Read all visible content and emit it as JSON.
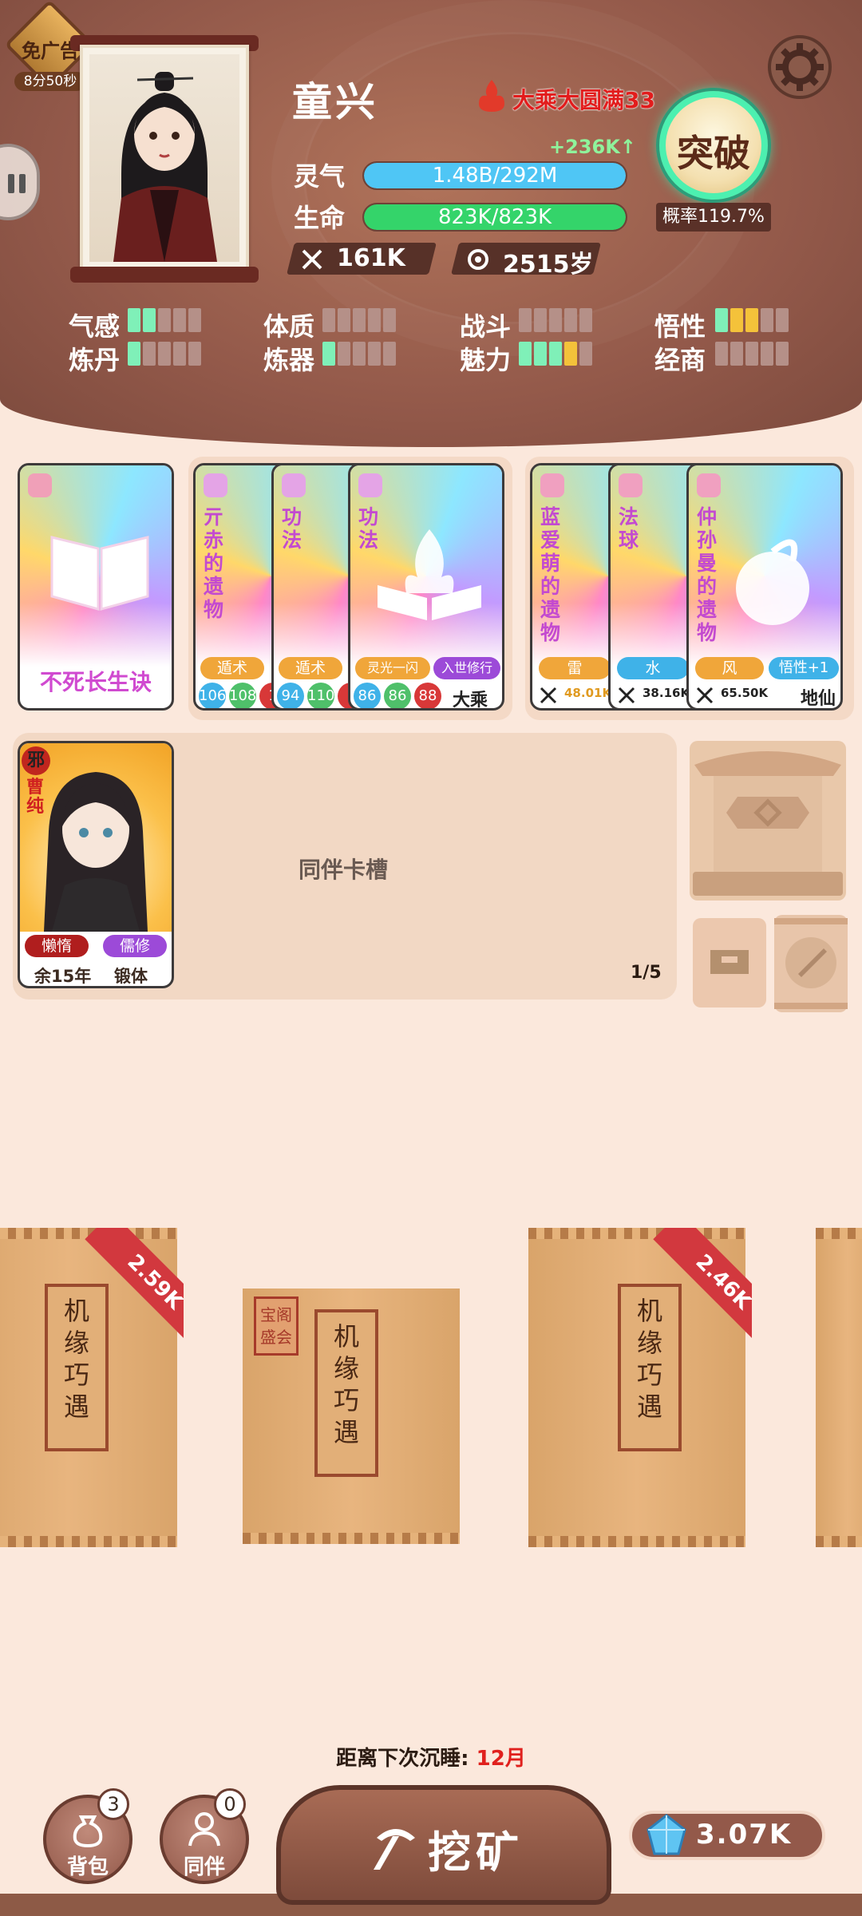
{
  "ad_badge": {
    "label": "免广告",
    "timer": "8分50秒"
  },
  "player": {
    "name": "童兴",
    "realm": "大乘大圆满33",
    "lingqi_gain": "+236K↑",
    "lingqi_label": "灵气",
    "lingqi_value": "1.48B/292M",
    "lingqi_progress": 1.0,
    "hp_label": "生命",
    "hp_value": "823K/823K",
    "hp_progress": 1.0,
    "power": "161K",
    "age": "2515岁"
  },
  "breakthrough": {
    "label": "突破",
    "probability": "概率119.7%"
  },
  "traits": [
    {
      "label": "气感",
      "green": 2,
      "yellow": 0
    },
    {
      "label": "体质",
      "green": 0,
      "yellow": 0
    },
    {
      "label": "战斗",
      "green": 0,
      "yellow": 0
    },
    {
      "label": "悟性",
      "green": 1,
      "yellow": 2
    },
    {
      "label": "炼丹",
      "green": 1,
      "yellow": 0
    },
    {
      "label": "炼器",
      "green": 1,
      "yellow": 0
    },
    {
      "label": "魅力",
      "green": 3,
      "yellow": 1
    },
    {
      "label": "经商",
      "green": 0,
      "yellow": 0
    }
  ],
  "technique_card": {
    "title": "不死长生诀"
  },
  "method_cards": [
    {
      "title": "亓赤的遗物",
      "tag": "遁术",
      "nums": [
        "106",
        "108",
        "1"
      ]
    },
    {
      "title": "功法",
      "tag": "遁术",
      "nums": [
        "94",
        "110",
        "1"
      ]
    },
    {
      "title": "功法",
      "tag": "灵光一闪",
      "tag2": "入世修行",
      "nums": [
        "86",
        "86",
        "88"
      ],
      "rank": "大乘"
    }
  ],
  "relic_cards": [
    {
      "title": "蓝爱萌的遗物",
      "tag": "雷",
      "power": "48.01K"
    },
    {
      "title": "法球",
      "tag": "水",
      "power": "38.16K"
    },
    {
      "title": "仲孙曼的遗物",
      "tag": "风",
      "tag2": "悟性+1",
      "power": "65.50K",
      "rank": "地仙"
    }
  ],
  "companion": {
    "badge": "邪",
    "name": "曹纯",
    "trait1": "懒惰",
    "trait2": "儒修",
    "life": "余15年",
    "stage": "锻体",
    "slot_label": "同伴卡槽",
    "slot_count": "1/5"
  },
  "bags": [
    {
      "seal": [
        "机",
        "缘",
        "巧",
        "遇"
      ],
      "ribbon": "2.59K"
    },
    {
      "seal": [
        "机",
        "缘",
        "巧",
        "遇"
      ],
      "stamp": [
        "宝阁",
        "盛会"
      ]
    },
    {
      "seal": [
        "机",
        "缘",
        "巧",
        "遇"
      ],
      "ribbon": "2.46K"
    }
  ],
  "sleep": {
    "label": "距离下次沉睡:",
    "value": "12月"
  },
  "bottom": {
    "bag_label": "背包",
    "bag_count": "3",
    "companion_label": "同伴",
    "companion_count": "0",
    "mine_label": "挖矿",
    "gems": "3.07K"
  },
  "colors": {
    "lingqi": "#4fc6f5",
    "hp": "#34d46a",
    "realm": "#e21c1c",
    "accent": "#4cf0b0"
  }
}
